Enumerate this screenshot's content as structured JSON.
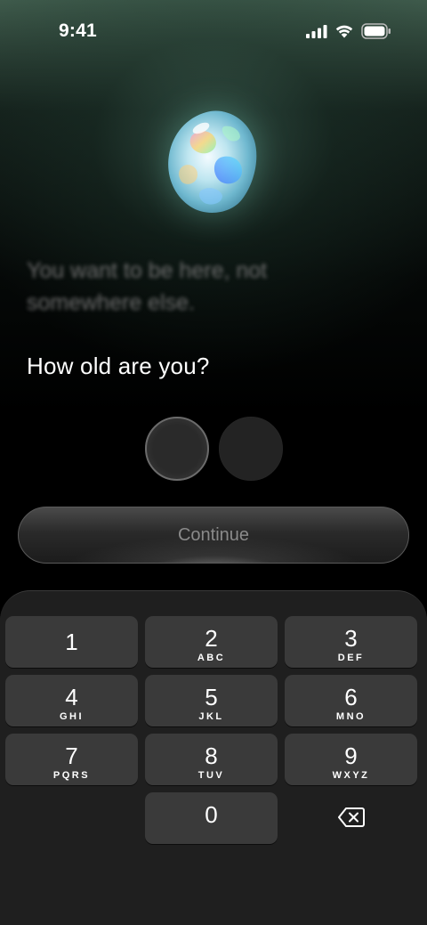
{
  "status_bar": {
    "time": "9:41",
    "icons": [
      "signal-icon",
      "wifi-icon",
      "battery-icon"
    ]
  },
  "hero": {
    "image": "opal-gem-icon",
    "blurred_text": "You want to be here, not somewhere else."
  },
  "form": {
    "question": "How old are you?",
    "digits": [
      "",
      ""
    ]
  },
  "continue_button": {
    "label": "Continue"
  },
  "keypad": {
    "keys": [
      {
        "num": "1",
        "letters": ""
      },
      {
        "num": "2",
        "letters": "ABC"
      },
      {
        "num": "3",
        "letters": "DEF"
      },
      {
        "num": "4",
        "letters": "GHI"
      },
      {
        "num": "5",
        "letters": "JKL"
      },
      {
        "num": "6",
        "letters": "MNO"
      },
      {
        "num": "7",
        "letters": "PQRS"
      },
      {
        "num": "8",
        "letters": "TUV"
      },
      {
        "num": "9",
        "letters": "WXYZ"
      },
      {
        "num": "0",
        "letters": ""
      }
    ],
    "delete_icon": "backspace-icon"
  },
  "colors": {
    "background": "#000000",
    "keypad_background": "#1f1f1f",
    "key_background": "#3a3a3a",
    "button_label": "#8a8a8a"
  }
}
